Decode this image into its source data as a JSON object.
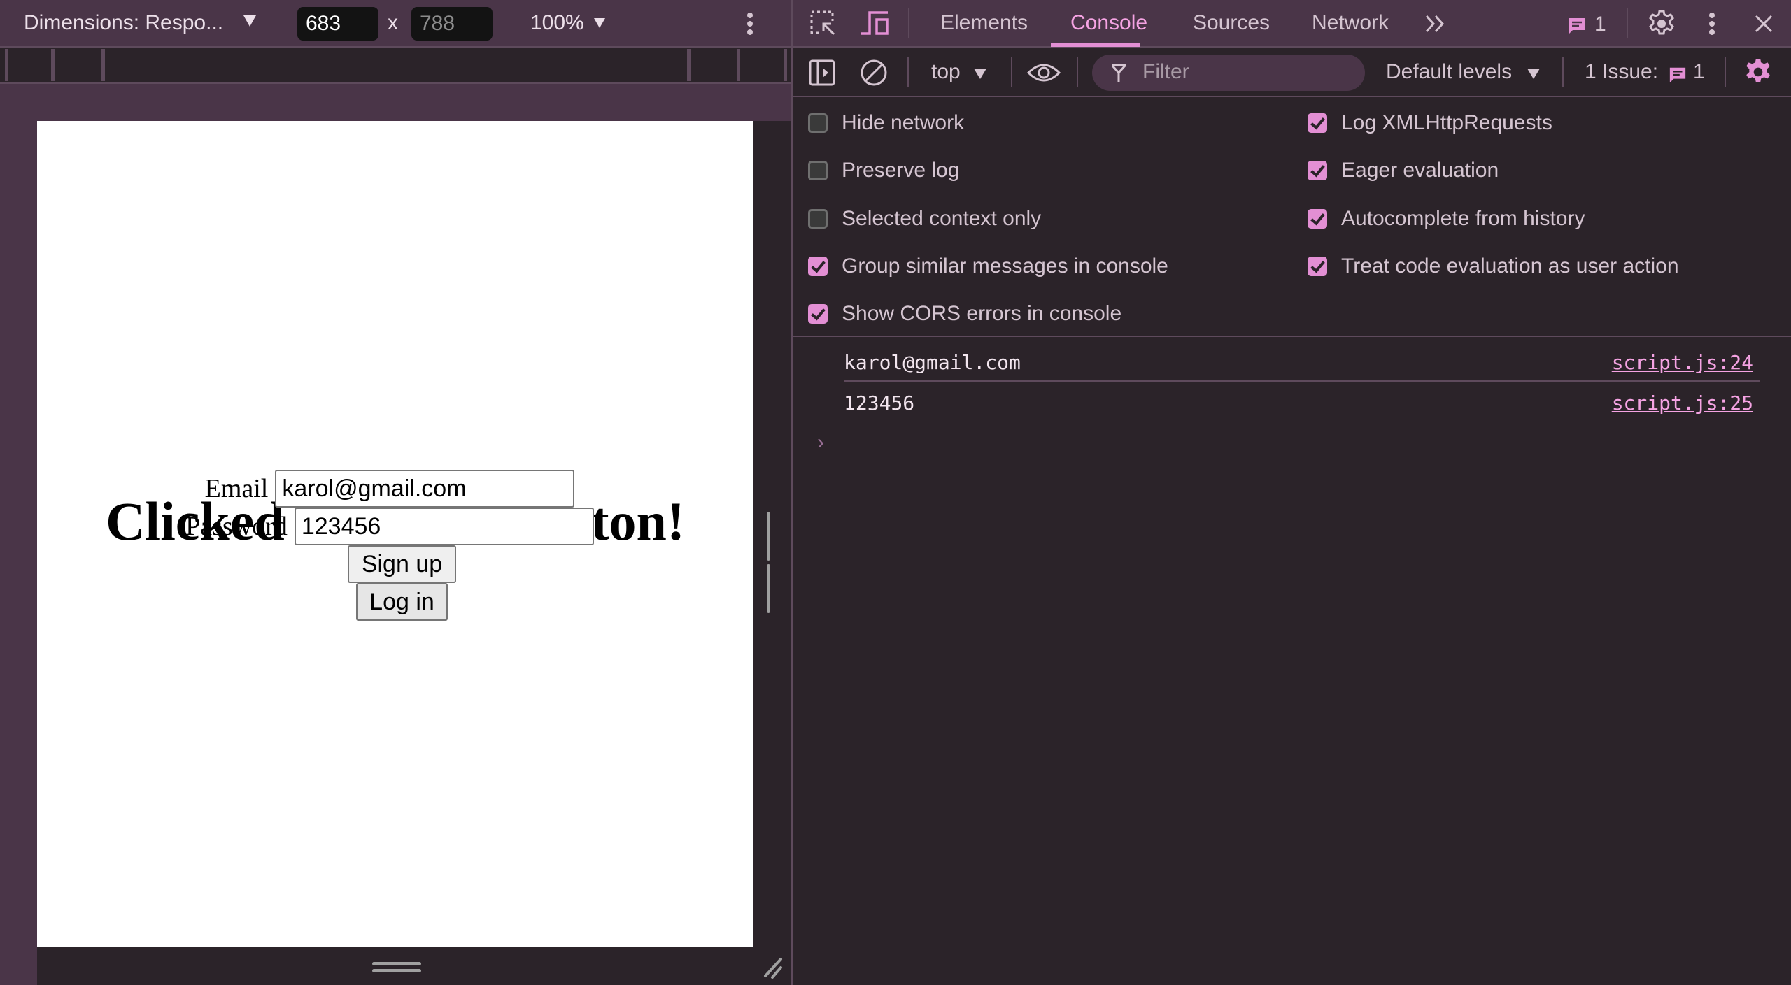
{
  "device_toolbar": {
    "dimensions_label": "Dimensions: Respo...",
    "width_value": "683",
    "height_value": "788",
    "times_symbol": "x",
    "zoom_label": "100%",
    "more_icon": "kebab-vertical-icon"
  },
  "page": {
    "heading": "Clicked on log in button!",
    "email_label": "Email",
    "email_value": "karol@gmail.com",
    "password_label": "Password",
    "password_value": "123456",
    "signup_button": "Sign up",
    "login_button": "Log in"
  },
  "devtools": {
    "tabs": [
      {
        "label": "Elements",
        "active": false
      },
      {
        "label": "Console",
        "active": true
      },
      {
        "label": "Sources",
        "active": false
      },
      {
        "label": "Network",
        "active": false
      }
    ],
    "more_tabs_icon": "chevron-double-right-icon",
    "issues_badge_count": "1",
    "accent_color": "#e38fd4",
    "console_toolbar": {
      "context": "top",
      "filter_placeholder": "Filter",
      "levels": "Default levels",
      "issues_label": "1 Issue:",
      "issues_count": "1"
    },
    "settings": {
      "left": [
        {
          "label": "Hide network",
          "checked": false
        },
        {
          "label": "Preserve log",
          "checked": false
        },
        {
          "label": "Selected context only",
          "checked": false
        },
        {
          "label": "Group similar messages in console",
          "checked": true
        },
        {
          "label": "Show CORS errors in console",
          "checked": true
        }
      ],
      "right": [
        {
          "label": "Log XMLHttpRequests",
          "checked": true
        },
        {
          "label": "Eager evaluation",
          "checked": true
        },
        {
          "label": "Autocomplete from history",
          "checked": true
        },
        {
          "label": "Treat code evaluation as user action",
          "checked": true
        }
      ]
    },
    "console_messages": [
      {
        "text": "karol@gmail.com",
        "source": "script.js:24"
      },
      {
        "text": "123456",
        "source": "script.js:25"
      }
    ],
    "prompt_symbol": "›"
  }
}
